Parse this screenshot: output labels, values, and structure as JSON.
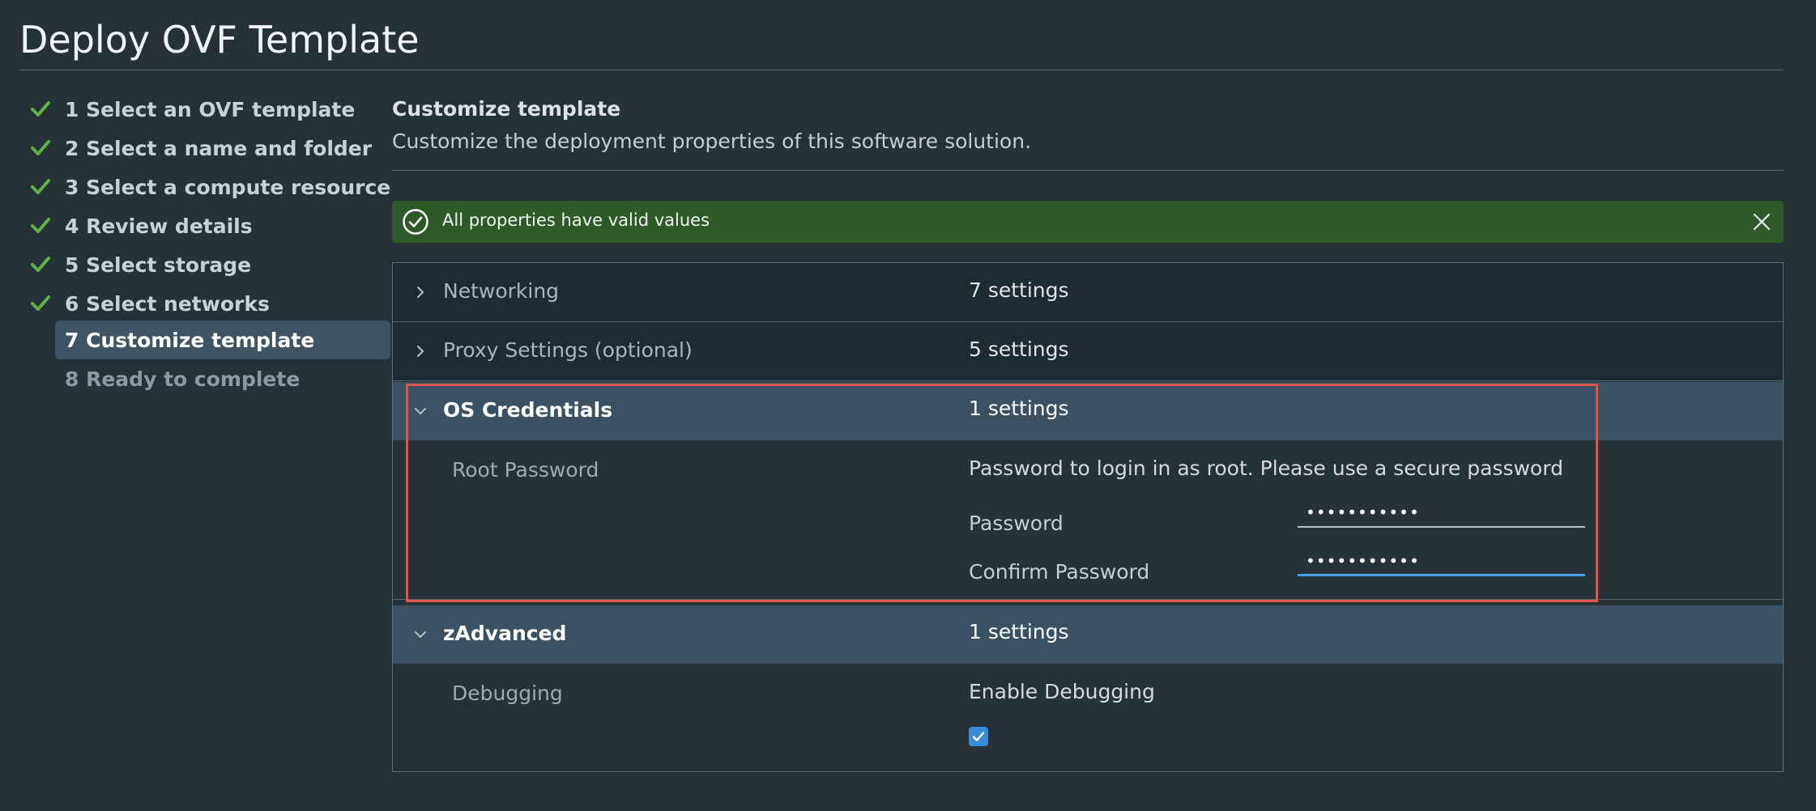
{
  "window": {
    "title": "Deploy OVF Template"
  },
  "steps": [
    {
      "label": "1 Select an OVF template",
      "state": "done"
    },
    {
      "label": "2 Select a name and folder",
      "state": "done"
    },
    {
      "label": "3 Select a compute resource",
      "state": "done"
    },
    {
      "label": "4 Review details",
      "state": "done"
    },
    {
      "label": "5 Select storage",
      "state": "done"
    },
    {
      "label": "6 Select networks",
      "state": "done"
    },
    {
      "label": "7 Customize template",
      "state": "current"
    },
    {
      "label": "8 Ready to complete",
      "state": "pending"
    }
  ],
  "main": {
    "title": "Customize template",
    "description": "Customize the deployment properties of this software solution."
  },
  "alert": {
    "message": "All properties have valid values",
    "status_color": "#2e5a27"
  },
  "groups": [
    {
      "name": "Networking",
      "count": "7 settings",
      "expanded": false
    },
    {
      "name": "Proxy Settings (optional)",
      "count": "5 settings",
      "expanded": false
    },
    {
      "name": "OS Credentials",
      "count": "1 settings",
      "expanded": true,
      "property": "Root Password",
      "description": "Password to login in as root. Please use a secure password",
      "password_label": "Password",
      "password_value": "•••••••••••",
      "confirm_label": "Confirm Password",
      "confirm_value": "•••••••••••"
    },
    {
      "name": "zAdvanced",
      "count": "1 settings",
      "expanded": true,
      "property": "Debugging",
      "description": "Enable Debugging",
      "checkbox_checked": true
    }
  ],
  "colors": {
    "accent": "#3b8bd6",
    "success": "#5db34a",
    "highlight_border": "#e0564b"
  }
}
